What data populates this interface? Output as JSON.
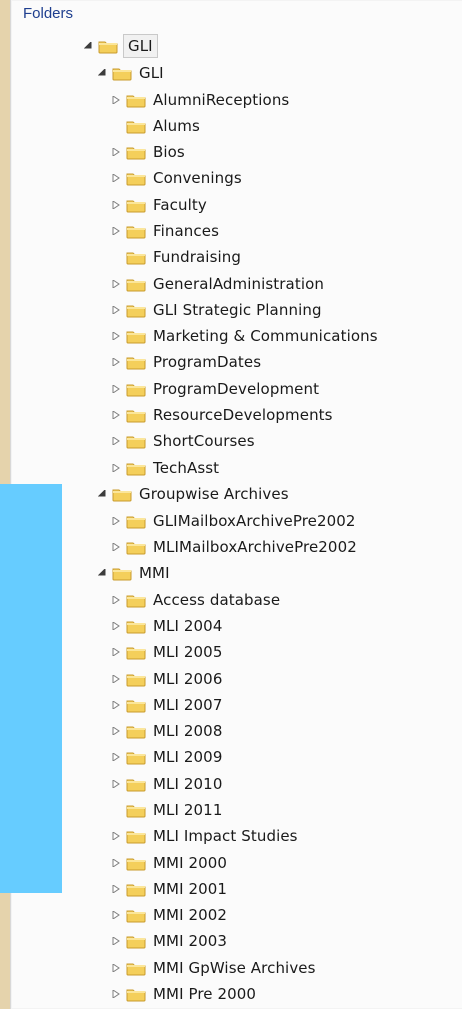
{
  "pane": {
    "title": "Folders"
  },
  "tree": {
    "root": {
      "label": "GLI"
    },
    "gli": {
      "label": "GLI",
      "children": [
        "AlumniReceptions",
        "Alums",
        "Bios",
        "Convenings",
        "Faculty",
        "Finances",
        "Fundraising",
        "GeneralAdministration",
        "GLI Strategic Planning",
        "Marketing & Communications",
        "ProgramDates",
        "ProgramDevelopment",
        "ResourceDevelopments",
        "ShortCourses",
        "TechAsst"
      ]
    },
    "groupwise": {
      "label": "Groupwise Archives",
      "children": [
        "GLIMailboxArchivePre2002",
        "MLIMailboxArchivePre2002"
      ]
    },
    "mmi": {
      "label": "MMI",
      "children": [
        "Access database",
        "MLI 2004",
        "MLI 2005",
        "MLI 2006",
        "MLI 2007",
        "MLI 2008",
        "MLI 2009",
        "MLI 2010",
        "MLI 2011",
        "MLI Impact Studies",
        "MMI 2000",
        "MMI 2001",
        "MMI 2002",
        "MMI 2003",
        "MMI GpWise Archives",
        "MMI Pre 2000"
      ]
    }
  },
  "colors": {
    "header": "#1f3f8f",
    "folder_main": "#f4cf5b",
    "folder_dark": "#d8ab34",
    "overlay": "#66ccff"
  },
  "icons": {
    "folder": "folder-icon",
    "expanded": "expanded-arrow-icon",
    "collapsed": "collapsed-arrow-icon"
  }
}
